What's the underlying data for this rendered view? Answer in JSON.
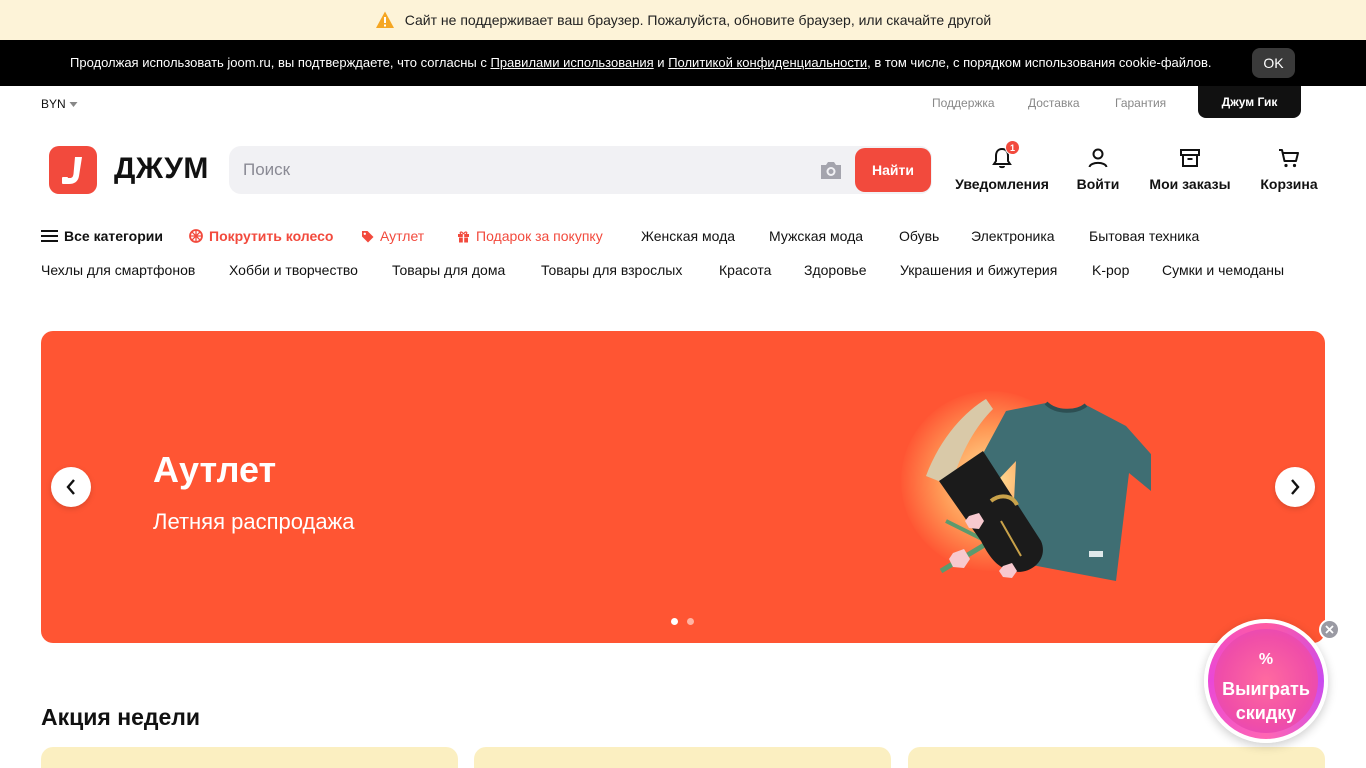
{
  "browser_warning": {
    "text": "Сайт не поддерживает ваш браузер. Пожалуйста, обновите браузер, или скачайте другой",
    "icon": "warning-icon"
  },
  "cookie": {
    "text_before": "Продолжая использовать joom.ru, вы подтверждаете, что согласны с ",
    "rules_link": "Правилами использования",
    "and": " и ",
    "privacy_link": "Политикой конфиденциальности",
    "text_after": ", в том числе, с порядком использования cookie-файлов.",
    "ok_label": "OK"
  },
  "util": {
    "currency": "BYN",
    "links": [
      "Поддержка",
      "Доставка",
      "Гарантия"
    ],
    "geek_label": "Джум Гик"
  },
  "header": {
    "logo_text": "ДЖУМ",
    "search_placeholder": "Поиск",
    "search_button": "Найти",
    "notifications_label": "Уведомления",
    "notifications_count": "1",
    "login_label": "Войти",
    "orders_label": "Мои заказы",
    "cart_label": "Корзина"
  },
  "nav_row1": {
    "all_categories": "Все категории",
    "wheel": "Покрутить колесо",
    "outlet": "Аутлет",
    "gift": "Подарок за покупку",
    "items": [
      "Женская мода",
      "Мужская мода",
      "Обувь",
      "Электроника",
      "Бытовая техника"
    ]
  },
  "nav_row2": [
    "Чехлы для смартфонов",
    "Хобби и творчество",
    "Товары для дома",
    "Товары для взрослых",
    "Красота",
    "Здоровье",
    "Украшения и бижутерия",
    "K-pop",
    "Сумки и чемоданы"
  ],
  "banner": {
    "title": "Аутлет",
    "subtitle": "Летняя распродажа",
    "slide_count": 2,
    "active_slide": 1,
    "bg_color": "#ff5533"
  },
  "section": {
    "title": "Акция недели"
  },
  "promo_wheel": {
    "symbol": "%",
    "line1": "Выиграть",
    "line2": "скидку"
  },
  "colors": {
    "accent": "#f24a3d",
    "cookie_bg": "#000000",
    "warning_bg": "#fdf3d8"
  }
}
